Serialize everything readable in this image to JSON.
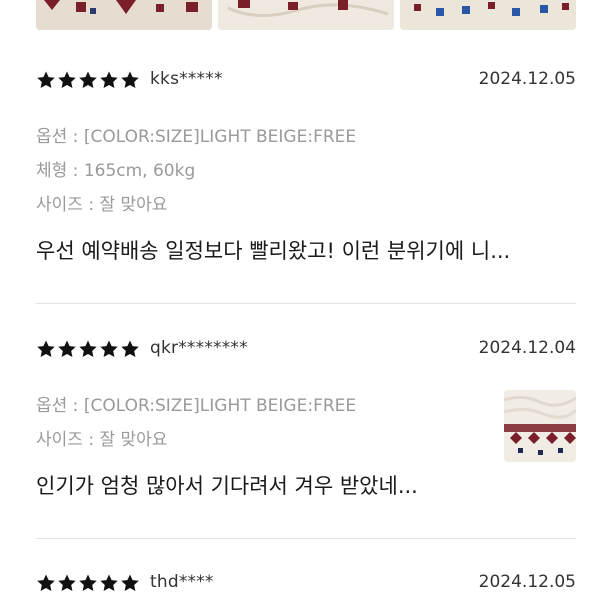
{
  "icons": {
    "star": "star-icon"
  },
  "colors": {
    "star": "#111111",
    "meta_text": "#9a9a9a",
    "divider": "#e2e2e2"
  },
  "reviews": [
    {
      "rating": 5,
      "user": "kks*****",
      "date": "2024.12.05",
      "option": "옵션 : [COLOR:SIZE]LIGHT BEIGE:FREE",
      "body_type": "체형 : 165cm, 60kg",
      "size": "사이즈 : 잘 맞아요",
      "text": "우선 예약배송 일정보다 빨리왔고! 이런 분위기에 니..."
    },
    {
      "rating": 5,
      "user": "qkr********",
      "date": "2024.12.04",
      "option": "옵션 : [COLOR:SIZE]LIGHT BEIGE:FREE",
      "size": "사이즈 : 잘 맞아요",
      "text": "인기가 엄청 많아서 기다려서 겨우 받았네..."
    },
    {
      "rating": 5,
      "user": "thd****",
      "date": "2024.12.05"
    }
  ]
}
